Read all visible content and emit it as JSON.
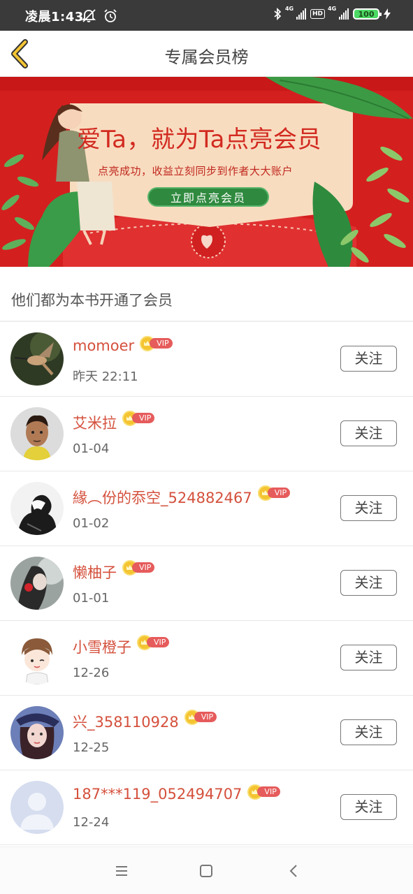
{
  "status_bar": {
    "time": "凌晨1:43",
    "network_1": "4G",
    "network_2": "4G",
    "hd_label": "HD",
    "battery": "100"
  },
  "header": {
    "title": "专属会员榜",
    "back_icon": "chevron-left-icon"
  },
  "banner": {
    "title": "爱Ta，就为Ta点亮会员",
    "subtitle": "点亮成功，收益立刻同步到作者大大账户",
    "button_label": "立即点亮会员",
    "colors": {
      "background": "#d41f1f",
      "card": "#f8dcc0",
      "button": "#2f8a3f",
      "leaf": "#2e8b3e"
    }
  },
  "section": {
    "heading": "他们都为本书开通了会员"
  },
  "members": [
    {
      "name": "momoer",
      "badge": "VIP",
      "date": "昨天 22:11",
      "follow_label": "关注",
      "avatar": "hummingbird"
    },
    {
      "name": "艾米拉",
      "badge": "VIP",
      "date": "01-04",
      "follow_label": "关注",
      "avatar": "man-portrait"
    },
    {
      "name": "緣︵份的忝空_524882467",
      "badge": "VIP",
      "date": "01-02",
      "follow_label": "关注",
      "avatar": "dark-figure"
    },
    {
      "name": "懒柚子",
      "badge": "VIP",
      "date": "01-01",
      "follow_label": "关注",
      "avatar": "girl-with-apple"
    },
    {
      "name": "小雪橙子",
      "badge": "VIP",
      "date": "12-26",
      "follow_label": "关注",
      "avatar": "cartoon-kid"
    },
    {
      "name": "兴_358110928",
      "badge": "VIP",
      "date": "12-25",
      "follow_label": "关注",
      "avatar": "woman-portrait"
    },
    {
      "name": "187***119_052494707",
      "badge": "VIP",
      "date": "12-24",
      "follow_label": "关注",
      "avatar": "default-user"
    }
  ],
  "nav": {
    "menu_icon": "menu-icon",
    "home_icon": "home-square-icon",
    "back_icon": "back-triangle-icon"
  },
  "colors": {
    "accent_name": "#d4503c",
    "vip_pill": "#e65b5b",
    "crown": "#f4c431"
  }
}
